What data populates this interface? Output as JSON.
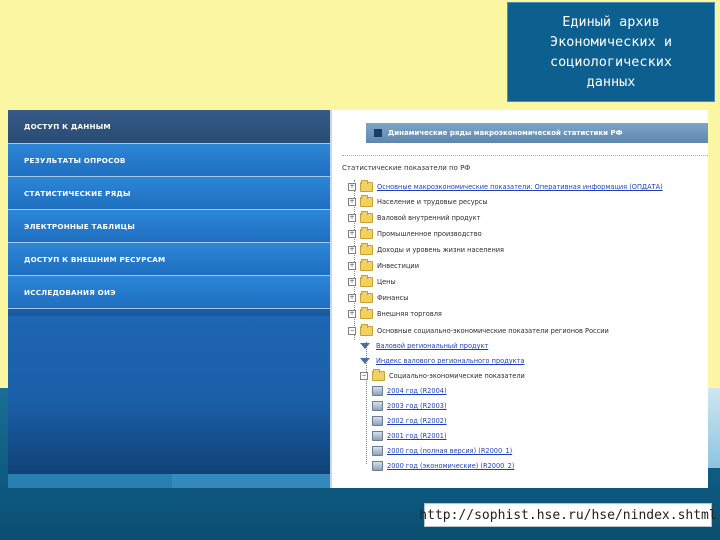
{
  "slide": {
    "title": "Единый архив\nЭкономических и\nсоциологических\nданных",
    "url": "http://sophist.hse.ru/hse/nindex.shtml"
  },
  "nav": {
    "items": [
      {
        "label": "ДОСТУП К ДАННЫМ",
        "active": true
      },
      {
        "label": "РЕЗУЛЬТАТЫ ОПРОСОВ"
      },
      {
        "label": "СТАТИСТИЧЕСКИЕ РЯДЫ"
      },
      {
        "label": "ЭЛЕКТРОННЫЕ ТАБЛИЦЫ"
      },
      {
        "label": "ДОСТУП К ВНЕШНИМ РЕСУРСАМ"
      },
      {
        "label": "ИССЛЕДОВАНИЯ ОИЭ"
      }
    ]
  },
  "content": {
    "header": "Динамические ряды макроэкономической статистики РФ",
    "tree_root": "Статистические показатели по РФ",
    "tree": [
      {
        "label": "Основные макроэкономические показатели. Оперативная информация (ОПДАТА)",
        "link": true
      },
      {
        "label": "Население и трудовые ресурсы",
        "link": false
      },
      {
        "label": "Валовой внутренний продукт",
        "link": false
      },
      {
        "label": "Промышленное производство",
        "link": false
      },
      {
        "label": "Доходы и уровень жизни населения",
        "link": false
      },
      {
        "label": "Инвестиции",
        "link": false
      },
      {
        "label": "Цены",
        "link": false
      },
      {
        "label": "Финансы",
        "link": false
      },
      {
        "label": "Внешняя торговля",
        "link": false
      },
      {
        "label": "Основные социально-экономические показатели регионов России",
        "link": false
      },
      {
        "label": "Валовой региональный продукт",
        "link": true
      },
      {
        "label": "Индекс валового регионального продукта",
        "link": true
      },
      {
        "label": "Социально-экономические показатели",
        "link": false
      },
      {
        "label": "2004 год (R2004)",
        "link": true
      },
      {
        "label": "2003 год (R2003)",
        "link": true
      },
      {
        "label": "2002 год (R2002)",
        "link": true
      },
      {
        "label": "2001 год (R2001)",
        "link": true
      },
      {
        "label": "2000 год (полная версия) (R2000_1)",
        "link": true
      },
      {
        "label": "2000 год (экономические) (R2000_2)",
        "link": true
      }
    ]
  },
  "colors": {
    "slide_background": "#fbf6a2",
    "title_box": "#0d5f8f",
    "nav_blue": "#1f6fc0",
    "link": "#1f3fbf"
  }
}
